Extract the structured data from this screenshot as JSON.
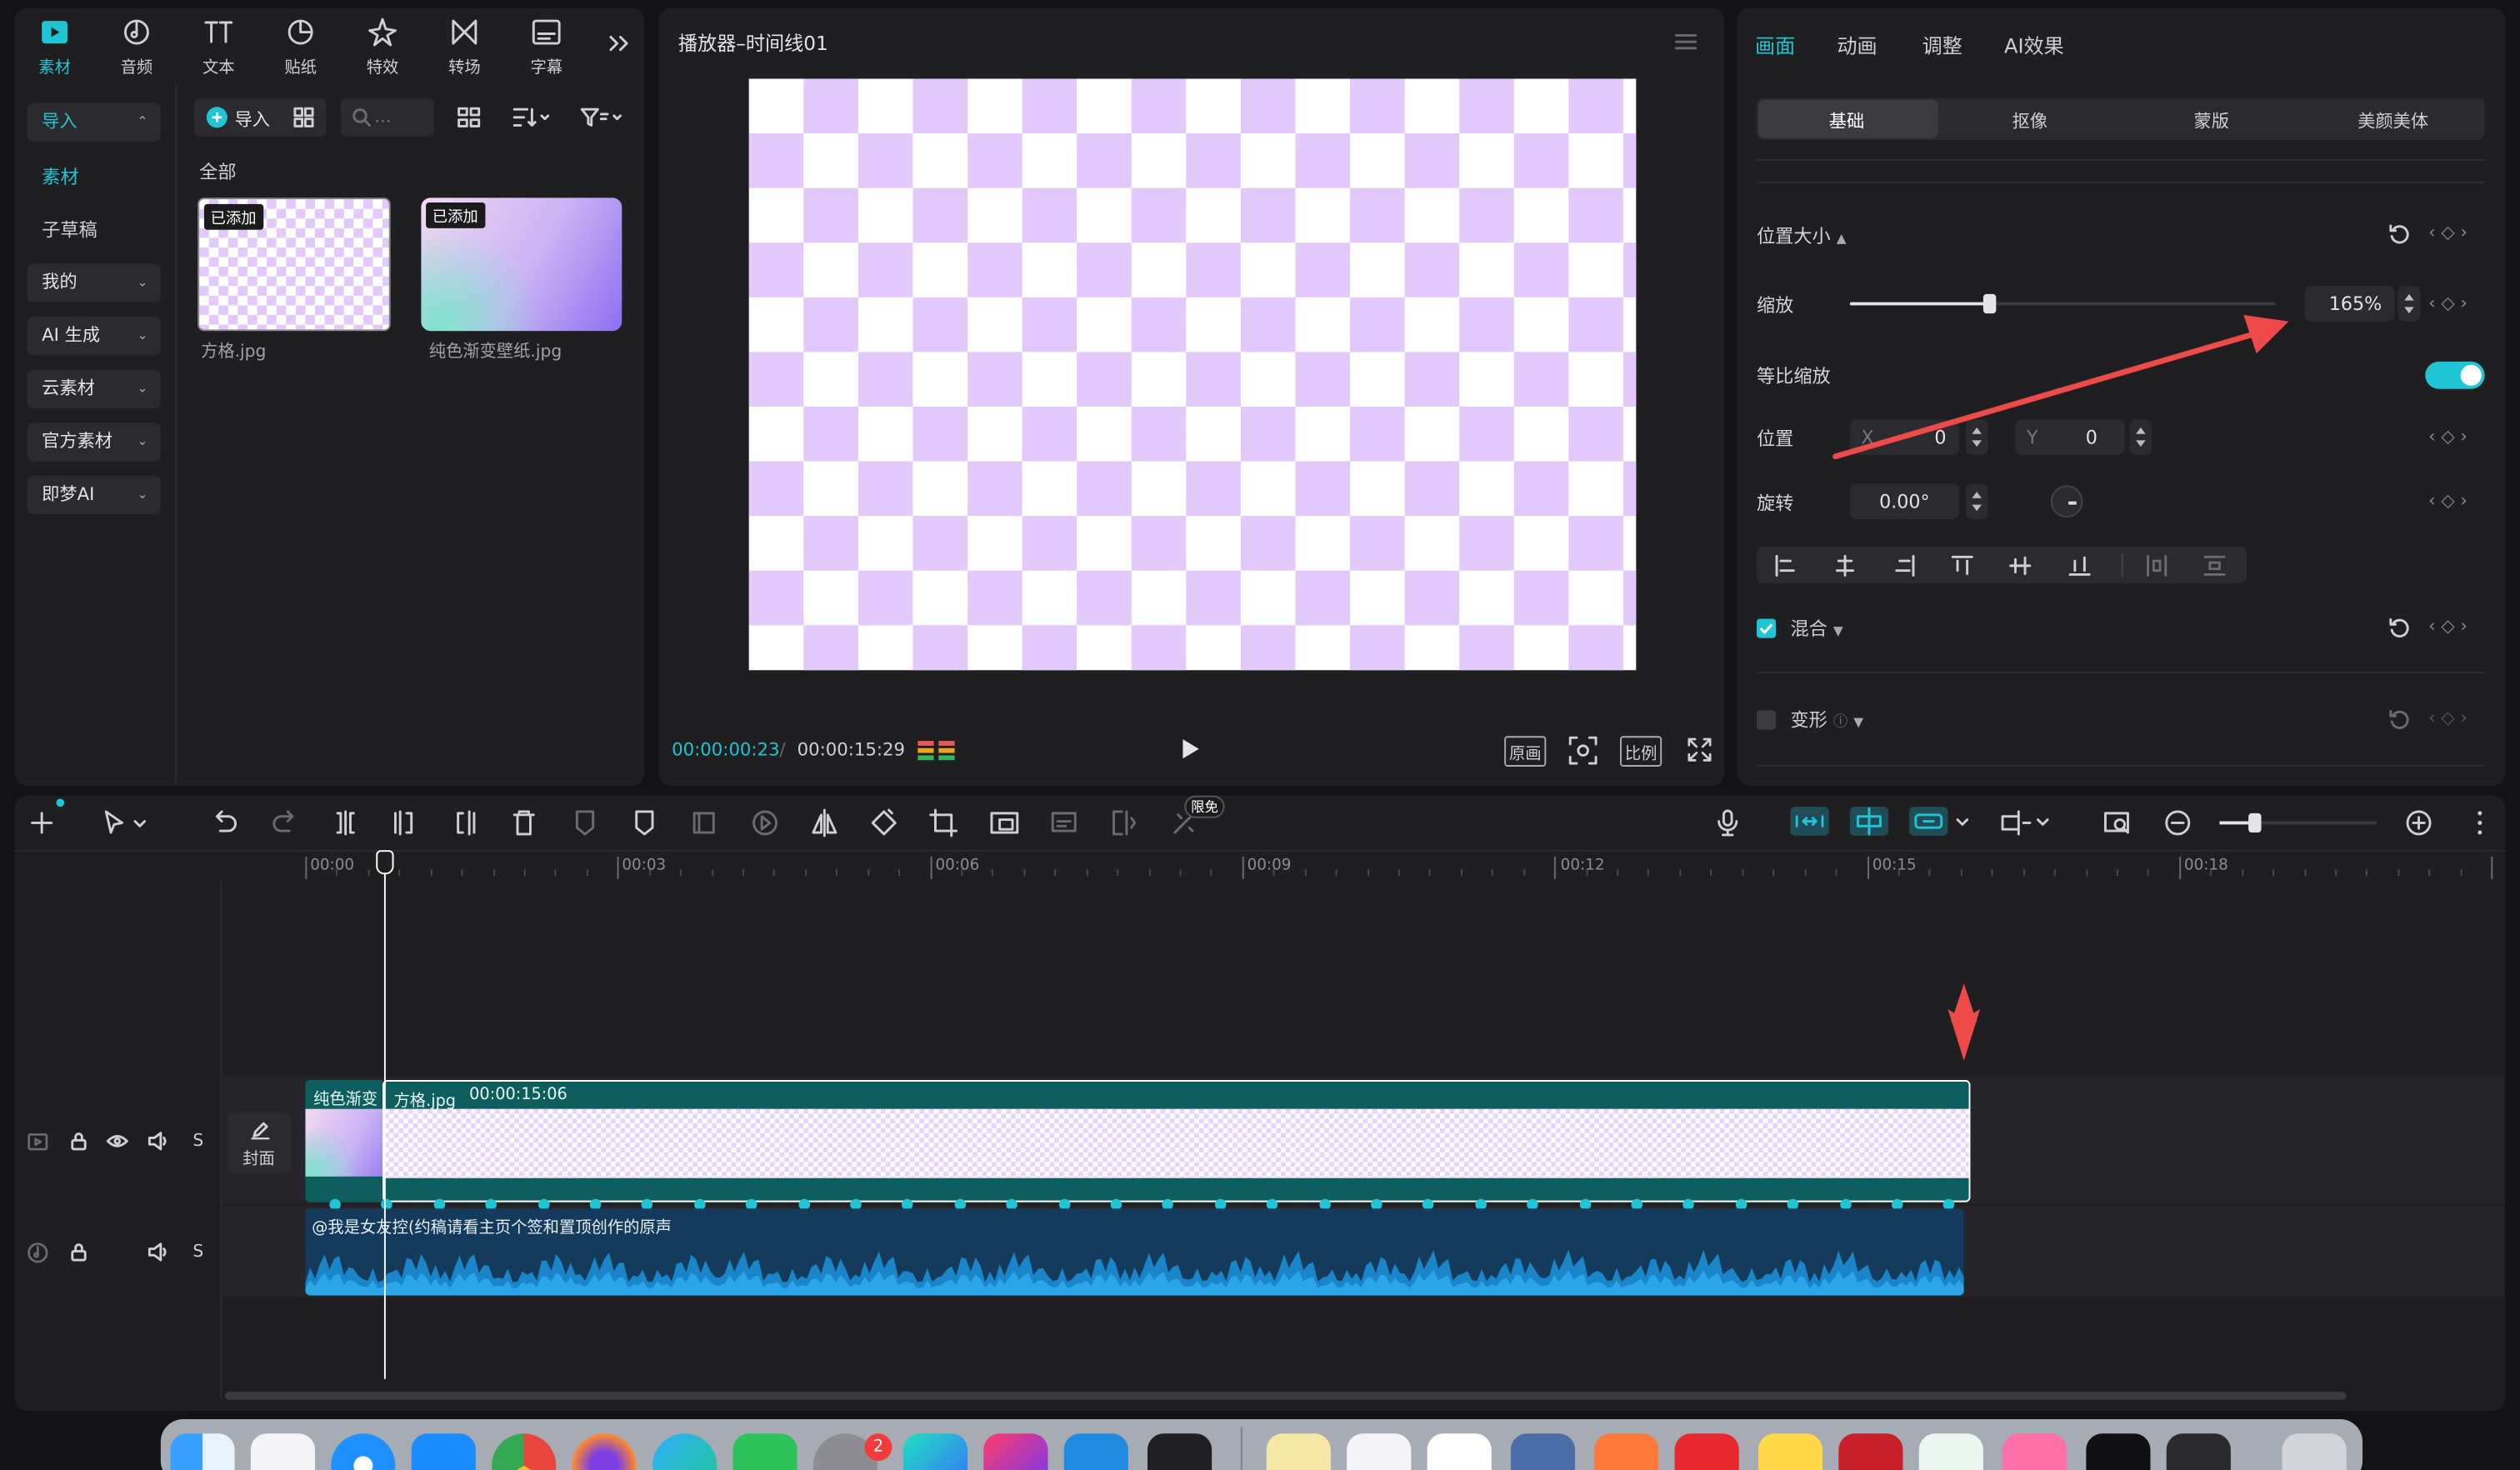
{
  "top_tabs": [
    {
      "label": "素材",
      "icon": "media-icon",
      "active": true
    },
    {
      "label": "音频",
      "icon": "audio-icon"
    },
    {
      "label": "文本",
      "icon": "text-icon"
    },
    {
      "label": "贴纸",
      "icon": "sticker-icon"
    },
    {
      "label": "特效",
      "icon": "effects-icon"
    },
    {
      "label": "转场",
      "icon": "transition-icon"
    },
    {
      "label": "字幕",
      "icon": "subtitle-icon"
    }
  ],
  "sidebar": {
    "import": "导入",
    "media": "素材",
    "sub_draft": "子草稿",
    "groups": [
      "我的",
      "AI 生成",
      "云素材",
      "官方素材",
      "即梦AI"
    ]
  },
  "media_toolbar": {
    "import_label": "导入",
    "search_placeholder": "..."
  },
  "media": {
    "section_label": "全部",
    "items": [
      {
        "name": "方格.jpg",
        "badge": "已添加"
      },
      {
        "name": "纯色渐变壁纸.jpg",
        "badge": "已添加"
      }
    ]
  },
  "player": {
    "title": "播放器–时间线01",
    "current_time": "00:00:00:23",
    "total_time": "00:00:15:29",
    "buttons": [
      "原画",
      "比例"
    ]
  },
  "inspector": {
    "tabs": [
      "画面",
      "动画",
      "调整",
      "AI效果"
    ],
    "sub_tabs": [
      "基础",
      "抠像",
      "蒙版",
      "美颜美体"
    ],
    "section_position": "位置大小",
    "scale_label": "缩放",
    "scale_value": "165%",
    "scale_fraction": 0.33,
    "uniform_label": "等比缩放",
    "uniform_enabled": true,
    "position_label": "位置",
    "x_label": "X",
    "x_value": "0",
    "y_label": "Y",
    "y_value": "0",
    "rotation_label": "旋转",
    "rotation_value": "0.00°",
    "blend_label": "混合",
    "blend_checked": true,
    "transform_label": "变形",
    "transform_checked": false
  },
  "timeline_toolbar": {
    "badge": "限免"
  },
  "ruler": [
    "00:00",
    "00:03",
    "00:06",
    "00:09",
    "00:12",
    "00:15",
    "00:18"
  ],
  "tracks": {
    "cover_label": "封面",
    "video_clip_a": "纯色渐变",
    "video_clip_b_name": "方格.jpg",
    "video_clip_b_duration": "00:00:15:06",
    "audio_clip": "@我是女友控(约稿请看主页个签和置顶创作的原声"
  },
  "dock": {
    "badge_count": "2"
  },
  "colors": {
    "accent": "#1fc5d4",
    "annotation": "#ee4a4a",
    "checker": "#e3c9fb"
  }
}
